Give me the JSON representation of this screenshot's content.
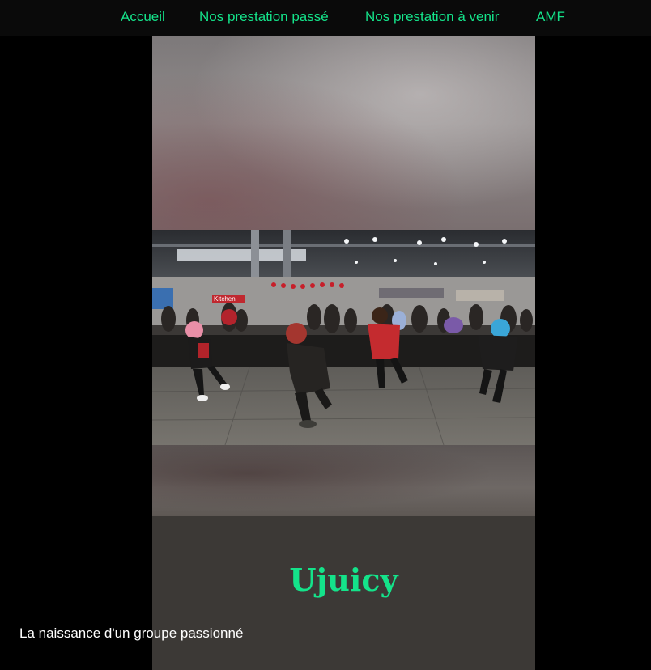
{
  "nav": {
    "items": [
      {
        "label": "Accueil"
      },
      {
        "label": "Nos prestation passé"
      },
      {
        "label": "Nos prestation à venir"
      },
      {
        "label": "AMF"
      }
    ]
  },
  "hero": {
    "title": "Ujuicy",
    "subtitle": "La naissance d'un groupe passionné"
  },
  "video": {
    "scene_sign": "Kitchen"
  },
  "colors": {
    "accent": "#14e38a",
    "background": "#000000",
    "panel": "#3c3936"
  }
}
